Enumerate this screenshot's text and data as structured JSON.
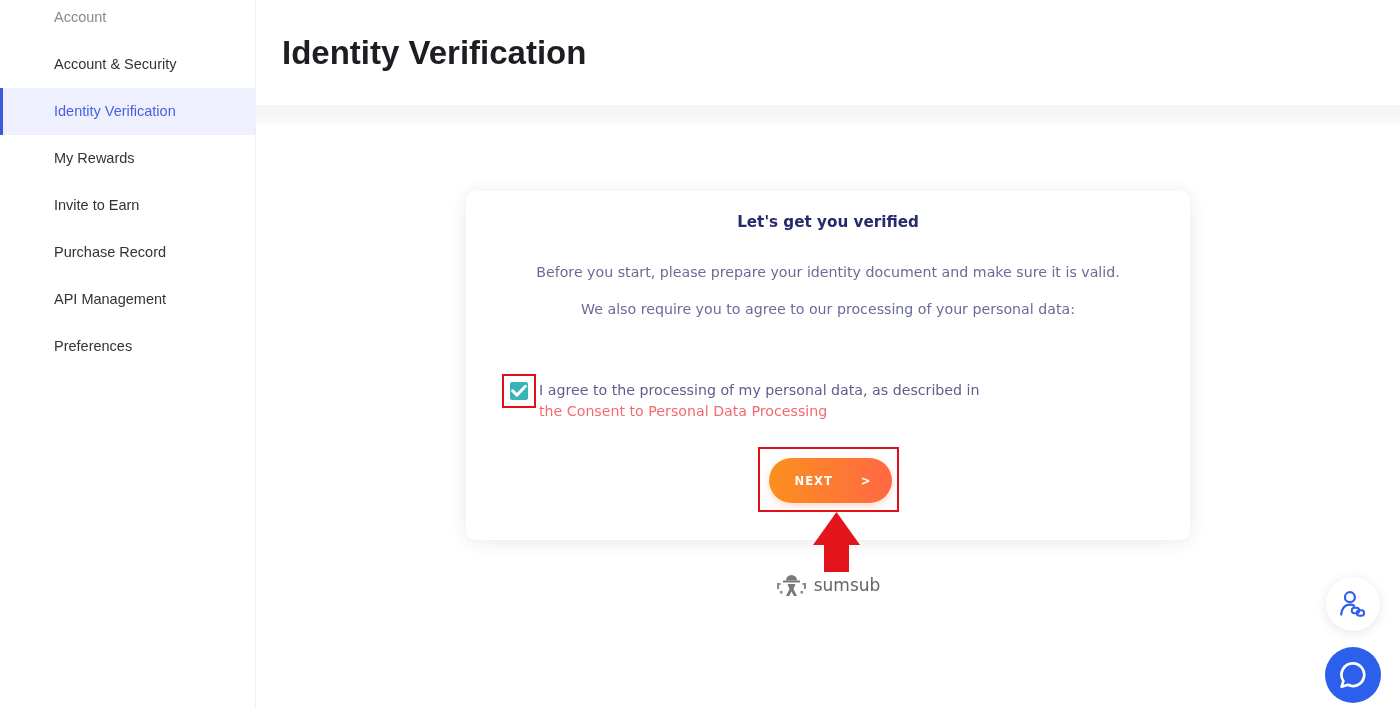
{
  "sidebar": {
    "heading": "Account",
    "items": [
      {
        "label": "Account & Security",
        "selected": false
      },
      {
        "label": "Identity Verification",
        "selected": true
      },
      {
        "label": "My Rewards",
        "selected": false
      },
      {
        "label": "Invite to Earn",
        "selected": false
      },
      {
        "label": "Purchase Record",
        "selected": false
      },
      {
        "label": "API Management",
        "selected": false
      },
      {
        "label": "Preferences",
        "selected": false
      }
    ]
  },
  "page": {
    "title": "Identity Verification"
  },
  "verification_card": {
    "title": "Let's get you verified",
    "paragraphs": [
      "Before you start, please prepare your identity document and make sure it is valid.",
      "We also require you to agree to our processing of your personal data:"
    ],
    "consent": {
      "checked": true,
      "highlighted": true,
      "text": "I agree to the processing of my personal data, as described in",
      "link": "the Consent to Personal Data Processing"
    },
    "next_button": {
      "label": "NEXT",
      "arrow": ">",
      "highlighted": true
    }
  },
  "provider": {
    "name": "sumsub"
  }
}
